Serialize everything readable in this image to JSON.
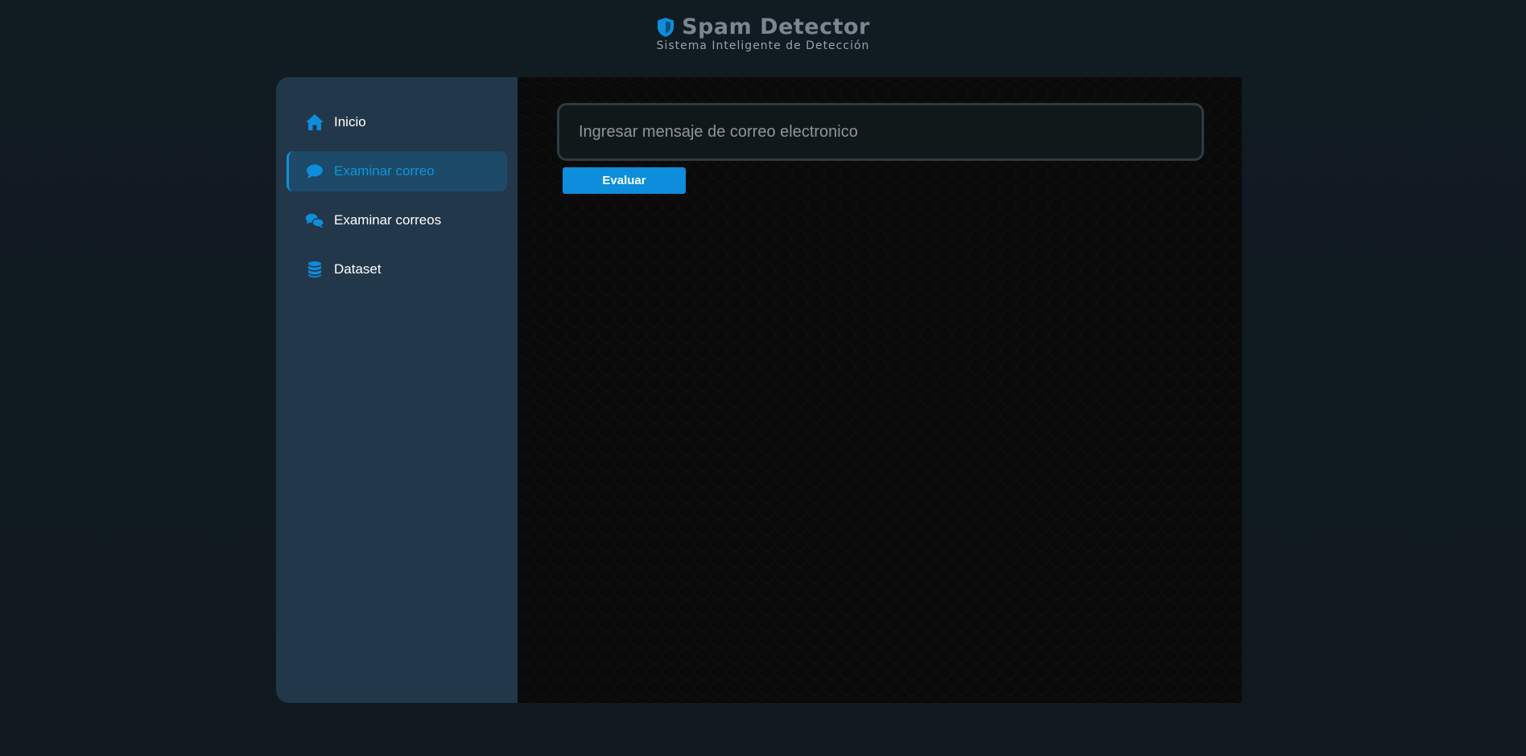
{
  "header": {
    "title": "Spam Detector",
    "subtitle": "Sistema Inteligente de Detección",
    "icon": "shield-icon"
  },
  "sidebar": {
    "items": [
      {
        "label": "Inicio",
        "icon": "home-icon",
        "active": false
      },
      {
        "label": "Examinar correo",
        "icon": "comment-icon",
        "active": true
      },
      {
        "label": "Examinar correos",
        "icon": "comments-icon",
        "active": false
      },
      {
        "label": "Dataset",
        "icon": "database-icon",
        "active": false
      }
    ]
  },
  "main": {
    "email_input": {
      "placeholder": "Ingresar mensaje de correo electronico",
      "value": ""
    },
    "evaluate_label": "Evaluar"
  },
  "colors": {
    "accent": "#0d8ddb",
    "sidebar_bg": "#23374a",
    "active_item_bg": "#1c4a68",
    "page_bg": "#111b22",
    "main_bg": "#0a0a0a"
  }
}
